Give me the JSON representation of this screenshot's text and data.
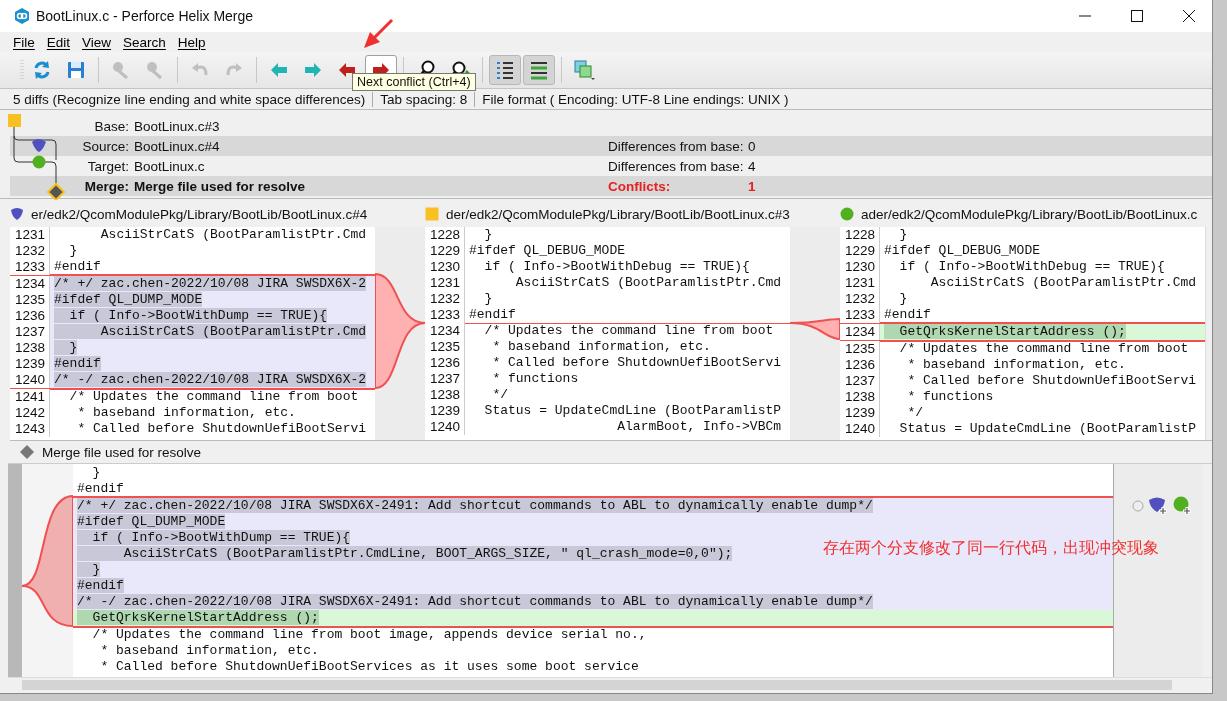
{
  "window": {
    "title": "BootLinux.c - Perforce Helix Merge"
  },
  "menu": [
    "File",
    "Edit",
    "View",
    "Search",
    "Help"
  ],
  "toolbar": [
    {
      "kind": "refresh",
      "disabled": false,
      "pressed": false,
      "hovered": false
    },
    {
      "kind": "save",
      "disabled": false,
      "pressed": false,
      "hovered": false
    },
    {
      "kind": "separator"
    },
    {
      "kind": "mark-left",
      "disabled": true,
      "pressed": false,
      "hovered": false
    },
    {
      "kind": "mark-right",
      "disabled": true,
      "pressed": false,
      "hovered": false
    },
    {
      "kind": "separator"
    },
    {
      "kind": "undo",
      "disabled": true,
      "pressed": false,
      "hovered": false
    },
    {
      "kind": "redo",
      "disabled": true,
      "pressed": false,
      "hovered": false
    },
    {
      "kind": "separator"
    },
    {
      "kind": "prev-diff",
      "disabled": false,
      "pressed": false,
      "hovered": false
    },
    {
      "kind": "next-diff",
      "disabled": false,
      "pressed": false,
      "hovered": false
    },
    {
      "kind": "prev-conflict",
      "disabled": false,
      "pressed": false,
      "hovered": false
    },
    {
      "kind": "next-conflict",
      "disabled": false,
      "pressed": false,
      "hovered": true
    },
    {
      "kind": "separator"
    },
    {
      "kind": "find",
      "disabled": false,
      "pressed": false,
      "hovered": false
    },
    {
      "kind": "find-next",
      "disabled": false,
      "pressed": false,
      "hovered": false
    },
    {
      "kind": "separator"
    },
    {
      "kind": "line-numbers",
      "disabled": false,
      "pressed": true,
      "hovered": false
    },
    {
      "kind": "diff-lines",
      "disabled": false,
      "pressed": true,
      "hovered": false
    },
    {
      "kind": "separator"
    },
    {
      "kind": "layout",
      "disabled": false,
      "pressed": false,
      "hovered": false
    }
  ],
  "tooltip": "Next conflict (Ctrl+4)",
  "status_bar": [
    "5 diffs (Recognize line ending and white space differences)",
    "Tab spacing: 8",
    "File format ( Encoding: UTF-8  Line endings: UNIX )"
  ],
  "files": [
    {
      "kind": "base",
      "label": "Base:",
      "name": "BootLinux.c#3"
    },
    {
      "kind": "source",
      "label": "Source:",
      "name": "BootLinux.c#4",
      "stat_label": "Differences from base:",
      "stat_value": "0",
      "alert": false
    },
    {
      "kind": "target",
      "label": "Target:",
      "name": "BootLinux.c",
      "stat_label": "Differences from base:",
      "stat_value": "4",
      "alert": false
    },
    {
      "kind": "merge",
      "label": "Merge:",
      "name": "Merge file used for resolve",
      "stat_label": "Conflicts:",
      "stat_value": "1",
      "alert": true
    }
  ],
  "panes": [
    {
      "kind": "source",
      "path": "er/edk2/QcomModulePkg/Library/BootLib/BootLinux.c#4",
      "lines": [
        {
          "number": "1231",
          "text": "      AsciiStrCatS (BootParamlistPtr.Cmd",
          "kind": "normal"
        },
        {
          "number": "1232",
          "text": "  }",
          "kind": "normal"
        },
        {
          "number": "1233",
          "text": "#endif",
          "kind": "normal"
        },
        {
          "number": "1234",
          "text": "/* +/ zac.chen-2022/10/08 JIRA SWSDX6X-2",
          "kind": "conflict"
        },
        {
          "number": "1235",
          "text": "#ifdef QL_DUMP_MODE",
          "kind": "conflict"
        },
        {
          "number": "1236",
          "text": "  if ( Info->BootWithDump == TRUE){",
          "kind": "conflict"
        },
        {
          "number": "1237",
          "text": "      AsciiStrCatS (BootParamlistPtr.Cmd",
          "kind": "conflict"
        },
        {
          "number": "1238",
          "text": "  }",
          "kind": "conflict"
        },
        {
          "number": "1239",
          "text": "#endif",
          "kind": "conflict"
        },
        {
          "number": "1240",
          "text": "/* -/ zac.chen-2022/10/08 JIRA SWSDX6X-2",
          "kind": "conflict"
        },
        {
          "number": "1241",
          "text": "  /* Updates the command line from boot",
          "kind": "normal"
        },
        {
          "number": "1242",
          "text": "   * baseband information, etc.",
          "kind": "normal"
        },
        {
          "number": "1243",
          "text": "   * Called before ShutdownUefiBootServi",
          "kind": "normal"
        }
      ]
    },
    {
      "kind": "base",
      "path": "der/edk2/QcomModulePkg/Library/BootLib/BootLinux.c#3",
      "lines": [
        {
          "number": "1228",
          "text": "  }",
          "kind": "normal"
        },
        {
          "number": "1229",
          "text": "#ifdef QL_DEBUG_MODE",
          "kind": "normal"
        },
        {
          "number": "1230",
          "text": "  if ( Info->BootWithDebug == TRUE){",
          "kind": "normal"
        },
        {
          "number": "1231",
          "text": "      AsciiStrCatS (BootParamlistPtr.Cmd",
          "kind": "normal"
        },
        {
          "number": "1232",
          "text": "  }",
          "kind": "normal"
        },
        {
          "number": "1233",
          "text": "#endif",
          "kind": "normal"
        },
        {
          "number": "1234",
          "text": "  /* Updates the command line from boot",
          "kind": "anchor"
        },
        {
          "number": "1235",
          "text": "   * baseband information, etc.",
          "kind": "normal"
        },
        {
          "number": "1236",
          "text": "   * Called before ShutdownUefiBootServi",
          "kind": "normal"
        },
        {
          "number": "1237",
          "text": "   * functions",
          "kind": "normal"
        },
        {
          "number": "1238",
          "text": "   */",
          "kind": "normal"
        },
        {
          "number": "1239",
          "text": "  Status = UpdateCmdLine (BootParamlistP",
          "kind": "normal"
        },
        {
          "number": "1240",
          "text": "                   AlarmBoot, Info->VBCm",
          "kind": "normal"
        }
      ]
    },
    {
      "kind": "target",
      "path": "ader/edk2/QcomModulePkg/Library/BootLib/BootLinux.c",
      "lines": [
        {
          "number": "1228",
          "text": "  }",
          "kind": "normal"
        },
        {
          "number": "1229",
          "text": "#ifdef QL_DEBUG_MODE",
          "kind": "normal"
        },
        {
          "number": "1230",
          "text": "  if ( Info->BootWithDebug == TRUE){",
          "kind": "normal"
        },
        {
          "number": "1231",
          "text": "      AsciiStrCatS (BootParamlistPtr.Cmd",
          "kind": "normal"
        },
        {
          "number": "1232",
          "text": "  }",
          "kind": "normal"
        },
        {
          "number": "1233",
          "text": "#endif",
          "kind": "normal"
        },
        {
          "number": "1234",
          "text": "  GetQrksKernelStartAddress ();",
          "kind": "added"
        },
        {
          "number": "1235",
          "text": "  /* Updates the command line from boot",
          "kind": "normal"
        },
        {
          "number": "1236",
          "text": "   * baseband information, etc.",
          "kind": "normal"
        },
        {
          "number": "1237",
          "text": "   * Called before ShutdownUefiBootServi",
          "kind": "normal"
        },
        {
          "number": "1238",
          "text": "   * functions",
          "kind": "normal"
        },
        {
          "number": "1239",
          "text": "   */",
          "kind": "normal"
        },
        {
          "number": "1240",
          "text": "  Status = UpdateCmdLine (BootParamlistP",
          "kind": "normal"
        }
      ]
    }
  ],
  "merge": {
    "title": "Merge file used for resolve",
    "annotation": "存在两个分支修改了同一行代码，出现冲突现象",
    "lines": [
      {
        "text": "  }",
        "kind": "normal"
      },
      {
        "text": "#endif",
        "kind": "normal"
      },
      {
        "text": "/* +/ zac.chen-2022/10/08 JIRA SWSDX6X-2491: Add shortcut commands to ABL to dynamically enable dump*/",
        "kind": "conflict"
      },
      {
        "text": "#ifdef QL_DUMP_MODE",
        "kind": "conflict"
      },
      {
        "text": "  if ( Info->BootWithDump == TRUE){",
        "kind": "conflict"
      },
      {
        "text": "      AsciiStrCatS (BootParamlistPtr.CmdLine, BOOT_ARGS_SIZE, \" ql_crash_mode=0,0\");",
        "kind": "conflict"
      },
      {
        "text": "  }",
        "kind": "conflict"
      },
      {
        "text": "#endif",
        "kind": "conflict"
      },
      {
        "text": "/* -/ zac.chen-2022/10/08 JIRA SWSDX6X-2491: Add shortcut commands to ABL to dynamically enable dump*/",
        "kind": "conflict"
      },
      {
        "text": "  GetQrksKernelStartAddress ();",
        "kind": "added"
      },
      {
        "text": "  /* Updates the command line from boot image, appends device serial no.,",
        "kind": "normal"
      },
      {
        "text": "   * baseband information, etc.",
        "kind": "normal"
      },
      {
        "text": "   * Called before ShutdownUefiBootServices as it uses some boot service",
        "kind": "normal"
      }
    ]
  }
}
